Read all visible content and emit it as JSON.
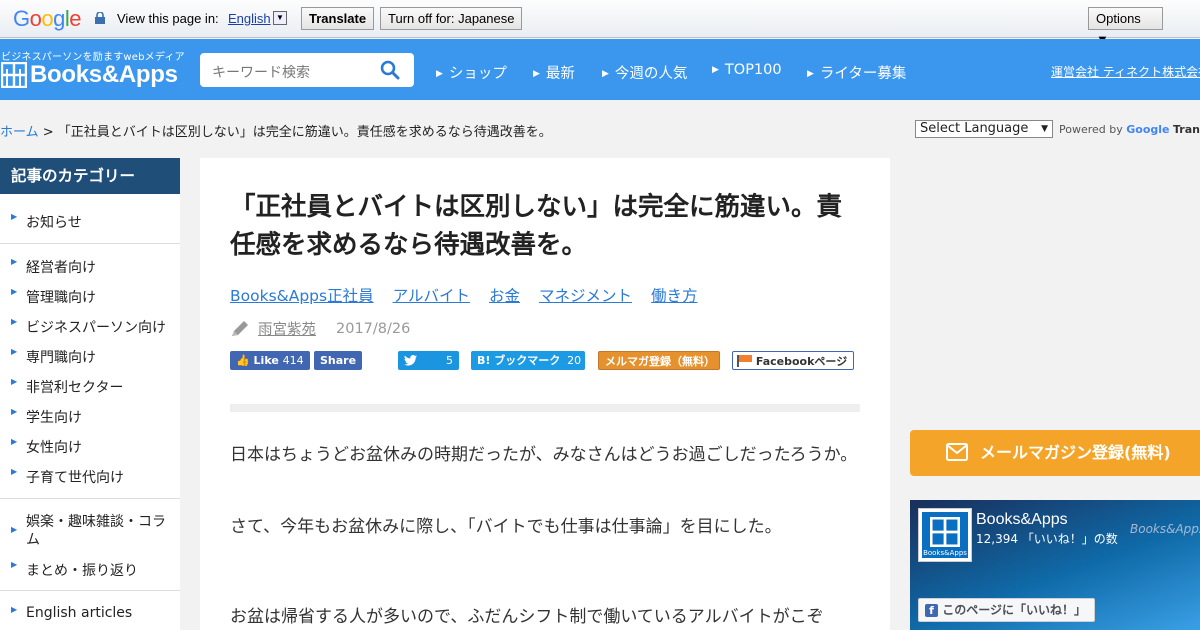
{
  "translate_bar": {
    "logo": "Google",
    "view_text": "View this page in:",
    "language": "English",
    "translate_label": "Translate",
    "turn_off_label": "Turn off for: Japanese",
    "options_label": "Options ▼"
  },
  "header": {
    "tagline": "ビジネスパーソンを励ますwebメディア",
    "logo_text": "Books&Apps",
    "search_placeholder": "キーワード検索",
    "nav": [
      "ショップ",
      "最新",
      "今週の人気",
      "TOP100",
      "ライター募集"
    ],
    "company_link": "運営会社 ティネクト株式会社"
  },
  "breadcrumb": {
    "home": "ホーム",
    "separator": " > ",
    "current": "「正社員とバイトは区別しない」は完全に筋違い。責任感を求めるなら待遇改善を。"
  },
  "language_widget": {
    "select_label": "Select Language",
    "powered_by": "Powered by",
    "google": "Google",
    "translate": "Translate"
  },
  "sidebar": {
    "heading": "記事のカテゴリー",
    "items": [
      "お知らせ",
      "経営者向け",
      "管理職向け",
      "ビジネスパーソン向け",
      "専門職向け",
      "非営利セクター",
      "学生向け",
      "女性向け",
      "子育て世代向け",
      "娯楽・趣味雑談・コラム",
      "まとめ・振り返り",
      "English articles"
    ]
  },
  "article": {
    "title": "「正社員とバイトは区別しない」は完全に筋違い。責任感を求めるなら待遇改善を。",
    "tags": [
      "Books&Apps正社員",
      "アルバイト",
      "お金",
      "マネジメント",
      "働き方"
    ],
    "author": "雨宮紫苑",
    "date": "2017/8/26",
    "social": {
      "fb_like_label": "Like",
      "fb_like_count": "414",
      "fb_share_label": "Share",
      "tweet_count": "5",
      "hatena_label": "ブックマーク",
      "hatena_count": "20",
      "mailmag_label": "メルマガ登録（無料）",
      "fb_page_label": "Facebookページ"
    },
    "paragraphs": [
      "日本はちょうどお盆休みの時期だったが、みなさんはどうお過ごしだったろうか。",
      "さて、今年もお盆休みに際し、「バイトでも仕事は仕事論」を目にした。",
      "お盆は帰省する人が多いので、ふだんシフト制で働いているアルバイトがこぞ"
    ]
  },
  "right": {
    "mail_button": "メールマガジン登録(無料)",
    "fb_widget": {
      "page_name": "Books&Apps",
      "likes_text": "12,394 「いいね！」の数",
      "like_button": "このページに「いいね！」",
      "avatar_text": "Books&Apps",
      "watermark": "Books&Apps"
    }
  },
  "colors": {
    "header_bg": "#3b97ee",
    "sidebar_head_bg": "#1f4e79",
    "link": "#2a7ad6",
    "mail_button": "#f5a42a"
  }
}
